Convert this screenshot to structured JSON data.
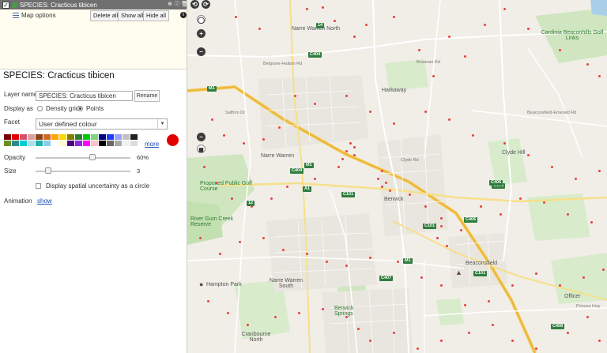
{
  "panel": {
    "layer_row": {
      "name": "SPECIES: Cracticus tibicen",
      "check": "✓"
    },
    "map_options": "Map options",
    "buttons": {
      "delete_all": "Delete all",
      "show_all": "Show all",
      "hide_all": "Hide all"
    },
    "info": "i",
    "title": "SPECIES: Cracticus tibicen",
    "layer_name_label": "Layer name",
    "layer_name_value": "SPECIES: Cracticus tibicen",
    "rename": "Rename",
    "display_as_label": "Display as",
    "display_options": [
      "Density grid",
      "Points"
    ],
    "display_selected": "Points",
    "facet_label": "Facet",
    "facet_value": "User defined colour",
    "more": "more",
    "selected_color": "#e10000",
    "opacity_label": "Opacity",
    "opacity_value": "60%",
    "opacity_fraction": 0.6,
    "size_label": "Size",
    "size_value": "3",
    "uncertainty_label": "Display spatial uncertainty as a circle",
    "animation_label": "Animation",
    "animation_link": "show",
    "swatches": [
      "#7f0000",
      "#e00000",
      "#d4526e",
      "#d8a0a0",
      "#8b4513",
      "#d2691e",
      "#ffa500",
      "#ffd700",
      "#808000",
      "#2e7d32",
      "#00c800",
      "#7fd47f",
      "#000080",
      "#1e3cff",
      "#9aa0ff",
      "#c0c0c0",
      "#222222",
      "#6b8e23",
      "#2e8b8b",
      "#00ced1",
      "#b0e0e6",
      "#20b2aa",
      "#87ceeb",
      "#ffffff",
      "#fffacd",
      "#4b0082",
      "#8a2be2",
      "#ff00ff",
      "#ffc0cb",
      "#000000",
      "#696969",
      "#a9a9a9",
      "#f0f0f0",
      "#dcdcdc"
    ]
  },
  "map": {
    "controls": [
      "⟲",
      "⟳",
      "+",
      "−",
      "◯",
      "◼"
    ],
    "labels": [
      {
        "text": "Narre Warren North",
        "cls": "big"
      },
      {
        "text": "Harkaway",
        "cls": "big"
      },
      {
        "text": "Cardinia Beaconhills Golf Links",
        "cls": "green"
      },
      {
        "text": "Narre Warren",
        "cls": "big"
      },
      {
        "text": "Clyde Hill",
        "cls": ""
      },
      {
        "text": "Proposed Public Golf Course",
        "cls": "green"
      },
      {
        "text": "Berwick",
        "cls": "big"
      },
      {
        "text": "River Gum Creek Reserve",
        "cls": "green"
      },
      {
        "text": "Beaconsfield",
        "cls": "big"
      },
      {
        "text": "Hampton Park",
        "cls": "big"
      },
      {
        "text": "Narre Warren South",
        "cls": "big"
      },
      {
        "text": "Berwick Springs",
        "cls": "green"
      },
      {
        "text": "Officer",
        "cls": "big"
      },
      {
        "text": "Cranbourne North",
        "cls": "big"
      },
      {
        "text": "Princes Hwy",
        "cls": "road"
      },
      {
        "text": "Belgrave-Hallam Rd",
        "cls": "road"
      },
      {
        "text": "Bowman Rd",
        "cls": "road"
      },
      {
        "text": "Beaconsfield-Emerald Rd",
        "cls": "road"
      },
      {
        "text": "Clyde Rd",
        "cls": "road"
      },
      {
        "text": "Saffron Dr",
        "cls": "road"
      }
    ],
    "shields": [
      "M1",
      "C404",
      "M1",
      "C404",
      "A1",
      "C101",
      "C101",
      "C406",
      "C101",
      "C407",
      "M1",
      "C101",
      "14",
      "12",
      "C406",
      "C408"
    ]
  }
}
